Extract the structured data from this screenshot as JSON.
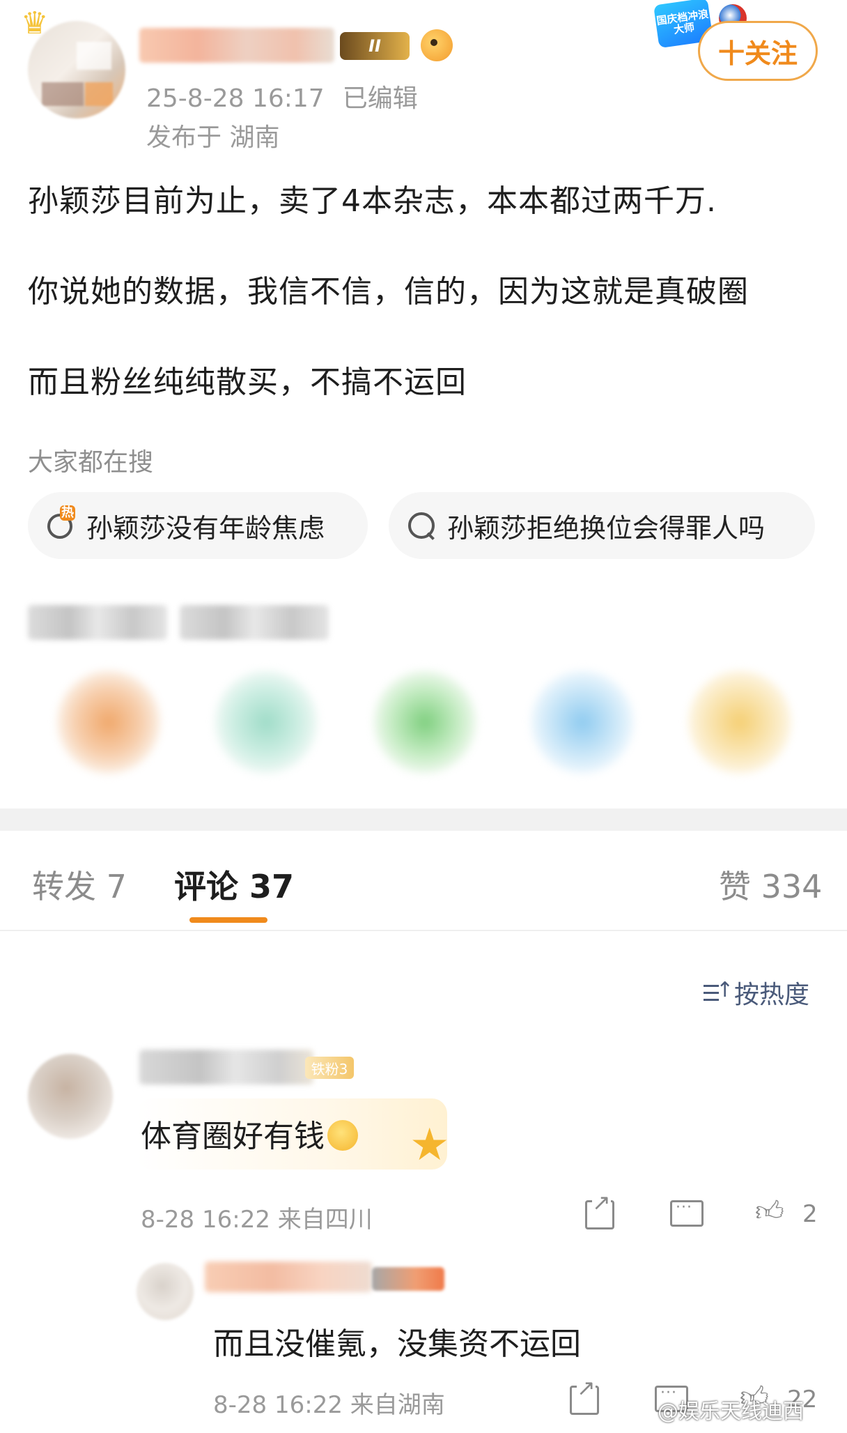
{
  "post": {
    "timestamp": "25-8-28 16:17",
    "edited": "已编辑",
    "location": "发布于 湖南",
    "follow_label": "十关注",
    "promo_badge_text": "国庆档冲浪大师",
    "level_badge": "II",
    "lines": [
      "孙颖莎目前为止，卖了4本杂志，本本都过两千万.",
      "你说她的数据，我信不信，信的，因为这就是真破圈",
      "而且粉丝纯纯散买，不搞不运回"
    ]
  },
  "search": {
    "label": "大家都在搜",
    "chips": [
      {
        "text": "孙颖莎没有年龄焦虑",
        "icon": "hot-search-icon"
      },
      {
        "text": "孙颖莎拒绝换位会得罪人吗",
        "icon": "search-icon"
      }
    ]
  },
  "tabs": {
    "repost": "转发 7",
    "comment": "评论 37",
    "like": "赞 334",
    "accent": "#f08a1c"
  },
  "sort_label": "按热度",
  "comments": [
    {
      "fan_badge": "铁粉3",
      "text": "体育圈好有钱",
      "meta": "8-28 16:22 来自四川",
      "likes": "2"
    }
  ],
  "reply": {
    "text": "而且没催氪，没集资不运回",
    "meta": "8-28 16:22 来自湖南",
    "likes": "22"
  },
  "watermark": "@娱乐天线迪西"
}
